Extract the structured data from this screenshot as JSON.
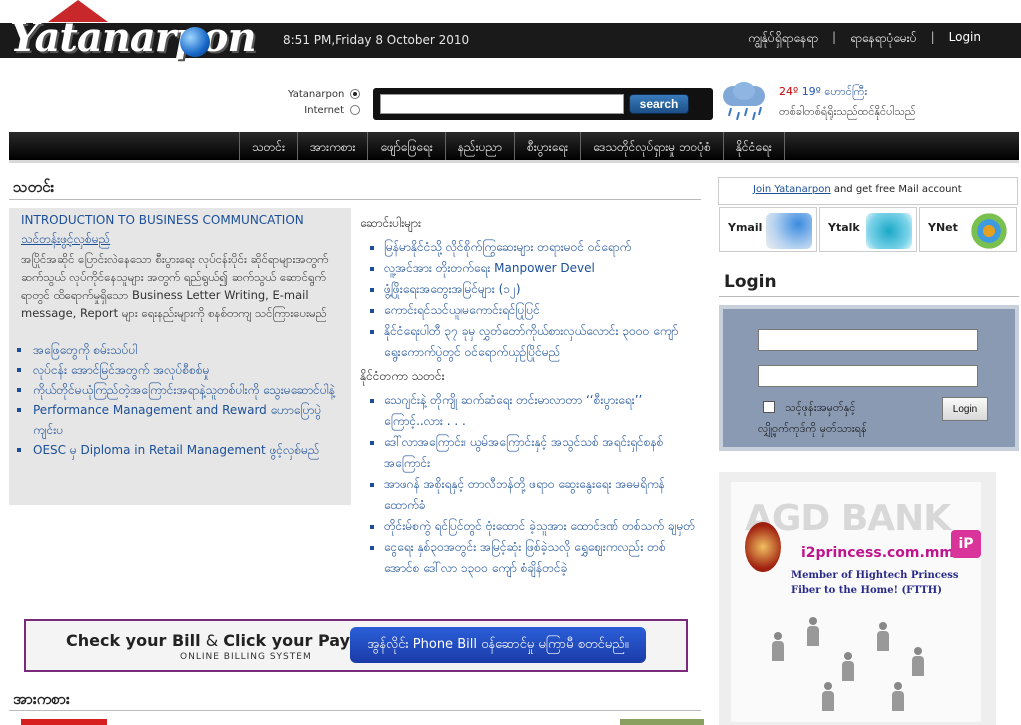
{
  "header": {
    "logo_text": "Yatanarpon",
    "datetime": "8:51 PM,Friday 8 October 2010",
    "links": [
      "ကျွန်ုပ်ရှိရာနေရာ",
      "ရာနေရာပုံမေးပ်",
      "Login"
    ]
  },
  "search": {
    "options": [
      "Yatanarpon",
      "Internet"
    ],
    "selected": "Yatanarpon",
    "query": "",
    "button_label": "search"
  },
  "weather": {
    "high": "24º",
    "low": "19º",
    "location": "ဟောင်ကြီး",
    "description": "တစ်ခါတစ်ရံရိုးသည်ထင်နိုင်ပါသည်"
  },
  "nav": {
    "items": [
      "သတင်း",
      "အားကစား",
      "ဖျော်ဖြေရေး",
      "နည်းပညာ",
      "စီးပွားရေး",
      "ဒေသတိုင်လုပ်ရှားမှု ဘဝပုံစံ",
      "နိုင်ငံရေး"
    ]
  },
  "news": {
    "title": "သတင်း",
    "featured": {
      "title": "INTRODUCTION TO BUSINESS COMMUNCATION",
      "subtitle": "သင်တန်းဖွင့်လှစ်မည်",
      "body": "အပြိုင်အဆိုင် ပြောင်းလဲနေသော စီးပွားရေး လုပ်ငန်းပိုင်း ဆိုင်ရာများအတွက် ဆက်သွယ် လုပ်ကိုင်နေသူများ အတွက် ရည်ရွယ်၍ ဆက်သွယ် ဆောင်ရွက်ရာတွင် ထိရောက်မှုရှိသော Business Letter Writing, E-mail message, Report များ ရေးနည်းများကို စနစ်တကျ သင်ကြားပေးမည်",
      "links": [
        "အဖြေတွေကို စမ်းသပ်ပါ",
        "လုပ်ငန်း အောင်မြင်အတွက် အလုပ်စီစစ်မှု",
        "ကိုယ်တိုင်မယုံကြည်တဲ့အကြောင်းအရာနဲ့သူတစ်ပါးကို သွေးမဆောင်ပါနဲ့",
        "Performance Management and Reward ဟောပြောပွဲကျင်းပ",
        "OESC မှ Diploma in Retail Management ဖွင့်လှစ်မည်"
      ]
    },
    "groups": [
      {
        "title": "ဆောင်းပါးများ",
        "items": [
          "မြန်မာနိုင်ငံသို့ လိုင်စိုက်ကြွဆေးများ တရားမဝင် ဝင်ရောက်",
          "လူ့အင်အား တိုးတက်ရေး Manpower Devel",
          "ဖွံ့ဖြိုးရေးအတွေးအမြင်များ (၁၂)",
          "ကောင်းရင်သင်ယူ၊မကောင်းရင်ပြုပြင်",
          "နိုင်ငံရေးပါတီ ၃၇ ခုမှ လွှတ်တော်ကိုယ်စားလှယ်လောင်း ၃၀၀၀ ကျော် ရွေးကောက်ပွဲတွင် ဝင်ရောက်ယှဉ်ပြိုင်မည်"
        ]
      },
      {
        "title": "နိုင်ငံတကာ သတင်း",
        "items": [
          "သေဂျင်းနဲ့ တိုကျို ဆက်ဆံရေး တင်းမာလာတာ ‘‘စီးပွားရေး’’ ကြောင့်..လား . . .",
          "ဒေါ်လာအကြောင်း၊ ယွမ်အကြောင်းနှင့် အသွင်သစ် အရင်းရှင်စနစ်အကြောင်း",
          "အာဖဂန် အစိုးရနှင့် တာလီဘန်တို့ ဖရာဝ ဆွေးနွေးရေး အဓမရိကန် ထောက်ခံ",
          "တိုင်းမ်စကွဲ ရင်ပြင်တွင် ဗုံးထောင် ခဲ့သူအား ထောင်ဒဏ် တစ်သက် ချမှတ်",
          "ငွေရေး နှစ်၃၀အတွင်း အမြင့်ဆုံး ဖြစ်ခဲ့သလို ရွှေဈေးကလည်း တစ်အောင်စ ဒေါ်လာ ၁၃၀၀ ကျော် စံချိန်တင်ခဲ့"
        ]
      }
    ]
  },
  "bill_banner": {
    "check": "Check your Bill",
    "click": "Click your Payment",
    "online": "ONLINE BILLING SYSTEM",
    "cta": "အွန်လိုင်း Phone Bill ဝန်ဆောင်မှု မကြာမီ စတင်မည်။"
  },
  "sports": {
    "title": "အားကစား"
  },
  "sidebar": {
    "mail_link": "Join Yatanarpon",
    "mail_text": "and get free Mail account",
    "services": [
      "Ymail",
      "Ytalk",
      "YNet"
    ],
    "login_title": "Login",
    "remember_label": "သင့်ဖုန်းအမှတ်နှင့်",
    "login_button": "Login",
    "forgot_label": "လျှို့ဝှက်ကုဒ်ကို မှတ်သားရန်"
  },
  "ad": {
    "bank": "AGD BANK",
    "brand": "i2princess.com.mm",
    "line1": "Member of Hightech Princess",
    "line2": "Fiber to the Home! (FTTH)"
  }
}
